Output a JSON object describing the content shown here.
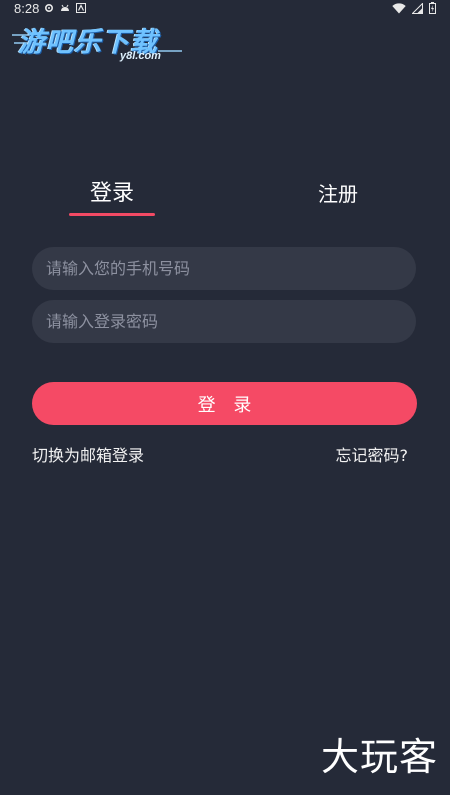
{
  "status_bar": {
    "time": "8:28"
  },
  "watermark": {
    "logo_title": "游吧乐下载",
    "logo_domain": "y8l.com",
    "corner_text": "大玩客"
  },
  "tabs": {
    "login_label": "登录",
    "register_label": "注册"
  },
  "form": {
    "phone_placeholder": "请输入您的手机号码",
    "phone_value": "",
    "password_placeholder": "请输入登录密码",
    "password_value": "",
    "login_button_label": "登 录"
  },
  "links": {
    "email_login": "切换为邮箱登录",
    "forgot_password": "忘记密码?"
  },
  "colors": {
    "background": "#252a38",
    "input_background": "#343947",
    "accent": "#f54a65"
  }
}
